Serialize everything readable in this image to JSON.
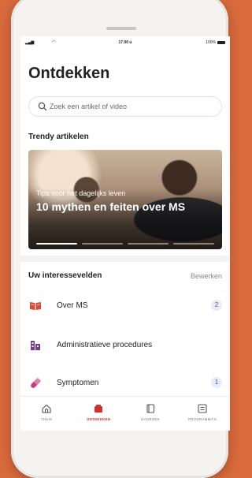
{
  "status_bar": {
    "time": "17.00 u",
    "battery": "100%"
  },
  "page": {
    "title": "Ontdekken"
  },
  "search": {
    "placeholder": "Zoek een artikel of video"
  },
  "trending": {
    "label": "Trendy artikelen",
    "article": {
      "eyebrow": "Tips voor het dagelijks leven",
      "headline": "10 mythen en feiten over MS"
    },
    "carousel_pages": 4,
    "carousel_active": 1
  },
  "interests": {
    "label": "Uw interessevelden",
    "edit_label": "Bewerken",
    "items": [
      {
        "label": "Over MS",
        "count": "2",
        "icon": "book-icon",
        "color": "#d94a3a"
      },
      {
        "label": "Administratieve procedures",
        "count": "",
        "icon": "building-icon",
        "color": "#7a3a8c"
      },
      {
        "label": "Symptomen",
        "count": "1",
        "icon": "pill-icon",
        "color": "#c73a7c"
      }
    ]
  },
  "tabbar": {
    "tabs": [
      {
        "label": "THUIS",
        "icon": "home-icon",
        "active": false
      },
      {
        "label": "ONTDEKKEN",
        "icon": "discover-icon",
        "active": true
      },
      {
        "label": "DAGBOEK",
        "icon": "diary-icon",
        "active": false
      },
      {
        "label": "PROGRAMMA'S",
        "icon": "programs-icon",
        "active": false
      }
    ]
  },
  "colors": {
    "accent": "#d0312d",
    "background": "#d96a3c"
  }
}
